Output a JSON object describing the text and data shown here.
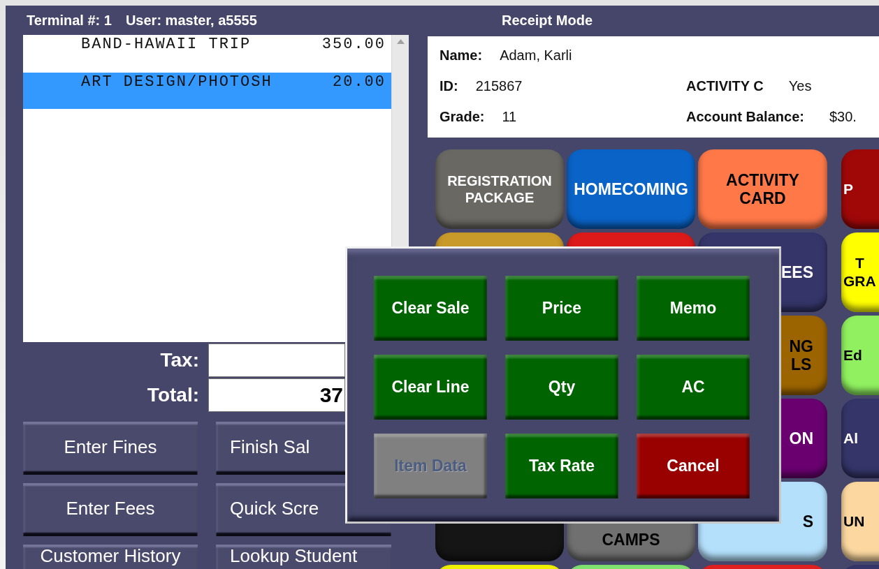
{
  "header": {
    "terminal": "Terminal #: 1",
    "user": "User: master, a5555",
    "mode": "Receipt Mode"
  },
  "receipt": {
    "items": [
      {
        "name": "BAND-HAWAII TRIP",
        "amount": "350.00",
        "selected": false
      },
      {
        "name": "ART DESIGN/PHOTOSH",
        "amount": "20.00",
        "selected": true
      }
    ]
  },
  "totals": {
    "tax_label": "Tax:",
    "total_label": "Total:",
    "total": "37"
  },
  "actions": [
    "Enter Fines",
    "Finish Sal",
    "Enter Fees",
    "Quick Scre",
    "Customer History",
    "Lookup Student"
  ],
  "customer": {
    "left": [
      {
        "label": "Name:",
        "value": "Adam, Karli"
      },
      {
        "label": "ID:",
        "value": "215867"
      },
      {
        "label": "Grade:",
        "value": "11"
      }
    ],
    "right": [
      {
        "label": "ACTIVITY C",
        "value": "Yes"
      },
      {
        "label": "Account Balance:",
        "value": "$30."
      }
    ]
  },
  "tiles": [
    [
      {
        "label": "REGISTRATION PACKAGE",
        "color": "#6a6862"
      },
      {
        "label": "HOMECOMING",
        "color": "#0a64c8"
      },
      {
        "label": "ACTIVITY CARD",
        "color": "#ff7848"
      },
      {
        "label": "P",
        "color": "#a00808"
      }
    ],
    [
      {
        "color": "#c89a2a"
      },
      {
        "color": "#dd1a1a"
      },
      {
        "label": "EES",
        "color": "#35356a"
      },
      {
        "label": "T GRA",
        "color": "#ffff00"
      }
    ],
    [
      {
        "label": "NG LS",
        "color": "#9c6400"
      },
      {
        "label": "Ed",
        "color": "#90f060"
      }
    ],
    [
      {
        "label": "ON",
        "color": "#6a0070"
      },
      {
        "label": "Al",
        "color": "#35356a"
      }
    ],
    [
      {
        "color": "#151515"
      },
      {
        "label": "CAMPS",
        "color": "#707070"
      },
      {
        "label": "S",
        "color": "#b4e0fc"
      },
      {
        "label": "UN",
        "color": "#fcd8a0"
      }
    ],
    [
      {
        "color": "#f0f000"
      },
      {
        "color": "#80e070"
      },
      {
        "color": "#e02020"
      },
      {
        "color": "#35356a"
      }
    ]
  ],
  "popup": {
    "buttons": [
      {
        "label": "Clear Sale",
        "kind": "action",
        "disabled": false
      },
      {
        "label": "Price",
        "kind": "action",
        "disabled": false
      },
      {
        "label": "Memo",
        "kind": "action",
        "disabled": false
      },
      {
        "label": "Clear Line",
        "kind": "action",
        "disabled": false
      },
      {
        "label": "Qty",
        "kind": "action",
        "disabled": false
      },
      {
        "label": "AC",
        "kind": "action",
        "disabled": false
      },
      {
        "label": "Item Data",
        "kind": "action",
        "disabled": true
      },
      {
        "label": "Tax Rate",
        "kind": "action",
        "disabled": false
      },
      {
        "label": "Cancel",
        "kind": "cancel",
        "disabled": false
      }
    ]
  }
}
